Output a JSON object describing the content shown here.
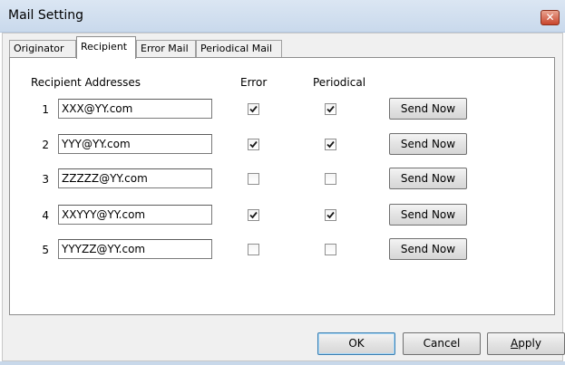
{
  "window": {
    "title": "Mail Setting",
    "close_glyph": "✕"
  },
  "tabs": [
    {
      "label": "Originator",
      "active": false
    },
    {
      "label": "Recipient",
      "active": true
    },
    {
      "label": "Error Mail",
      "active": false
    },
    {
      "label": "Periodical Mail",
      "active": false
    }
  ],
  "recipient": {
    "headers": {
      "addresses": "Recipient Addresses",
      "error": "Error",
      "periodical": "Periodical"
    },
    "rows": [
      {
        "num": "1",
        "address": "XXX@YY.com",
        "error": true,
        "periodical": true,
        "send_label": "Send Now"
      },
      {
        "num": "2",
        "address": "YYY@YY.com",
        "error": true,
        "periodical": true,
        "send_label": "Send Now"
      },
      {
        "num": "3",
        "address": "ZZZZZ@YY.com",
        "error": false,
        "periodical": false,
        "send_label": "Send Now"
      },
      {
        "num": "4",
        "address": "XXYYY@YY.com",
        "error": true,
        "periodical": true,
        "send_label": "Send Now"
      },
      {
        "num": "5",
        "address": "YYYZZ@YY.com",
        "error": false,
        "periodical": false,
        "send_label": "Send Now"
      }
    ]
  },
  "footer": {
    "ok_label": "OK",
    "cancel_label": "Cancel",
    "apply_label": "Apply"
  }
}
